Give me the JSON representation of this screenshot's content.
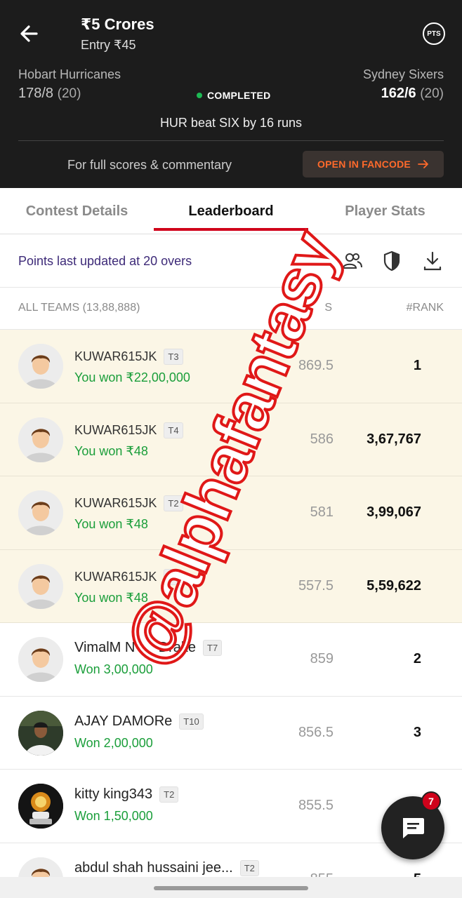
{
  "header": {
    "contest_title": "₹5 Crores",
    "entry": "Entry ₹45",
    "pts_label": "PTS",
    "team_left": {
      "name": "Hobart Hurricanes",
      "score": "178/8",
      "overs": "(20)"
    },
    "team_right": {
      "name": "Sydney Sixers",
      "score": "162/6",
      "overs": "(20)"
    },
    "status": "COMPLETED",
    "result": "HUR beat SIX by 16 runs",
    "commentary_text": "For full scores & commentary",
    "fancode_button": "OPEN IN FANCODE"
  },
  "tabs": [
    "Contest Details",
    "Leaderboard",
    "Player Stats"
  ],
  "update_text": "Points last updated at 20 overs",
  "list_header": {
    "all_teams": "ALL TEAMS (13,88,888)",
    "points": "S",
    "rank": "#RANK"
  },
  "rows": [
    {
      "name": "KUWAR615JK",
      "tag": "T3",
      "won": "You won ₹22,00,000",
      "points": "869.5",
      "rank": "1"
    },
    {
      "name": "KUWAR615JK",
      "tag": "T4",
      "won": "You won ₹48",
      "points": "586",
      "rank": "3,67,767"
    },
    {
      "name": "KUWAR615JK",
      "tag": "T2",
      "won": "You won ₹48",
      "points": "581",
      "rank": "3,99,067"
    },
    {
      "name": "KUWAR615JK",
      "tag": "T",
      "won": "You won ₹48",
      "points": "557.5",
      "rank": "5,59,622"
    },
    {
      "name": "VimalM N      Drake",
      "tag": "T7",
      "won": "Won 3,00,000",
      "points": "859",
      "rank": "2"
    },
    {
      "name": "AJAY DAMORe",
      "tag": "T10",
      "won": "Won 2,00,000",
      "points": "856.5",
      "rank": "3"
    },
    {
      "name": "kitty king343",
      "tag": "T2",
      "won": "Won 1,50,000",
      "points": "855.5",
      "rank": ""
    },
    {
      "name": "abdul shah hussaini jee...",
      "tag": "T2",
      "won": "",
      "points": "855",
      "rank": "5"
    }
  ],
  "fab_badge": "7",
  "watermark": "@alphafantasy",
  "colors": {
    "accent": "#d0021b",
    "won_green": "#1a9e3a",
    "fancode_orange": "#ff6a2b",
    "highlight_row": "#fbf6e6"
  }
}
